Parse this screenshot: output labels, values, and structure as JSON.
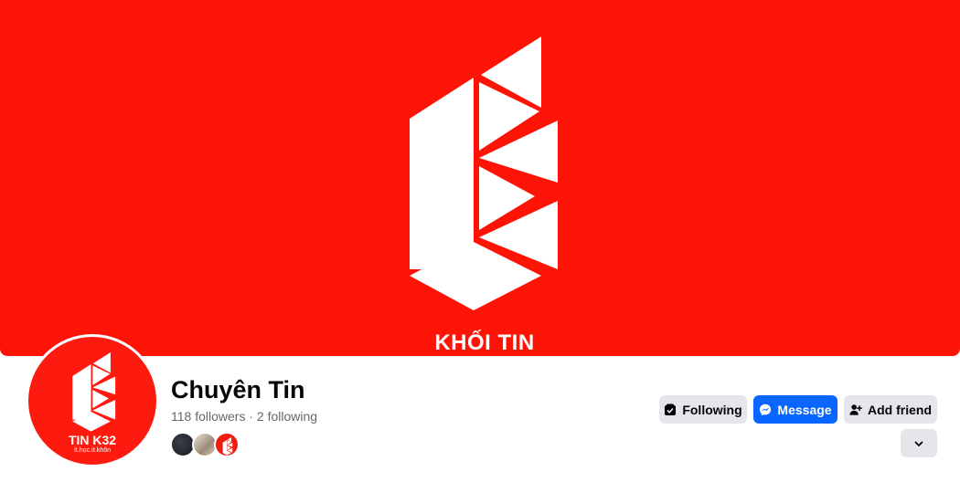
{
  "cover": {
    "caption": "KHỐI TIN",
    "background": "#fe1407"
  },
  "avatar": {
    "title": "TIN K32",
    "subtitle": "ít.học.ít.khôn"
  },
  "profile": {
    "name": "Chuyên Tin",
    "followers": "118 followers",
    "separator": "·",
    "following": "2 following"
  },
  "actions": {
    "following_label": "Following",
    "message_label": "Message",
    "add_friend_label": "Add friend",
    "more_icon": "chevron-down-icon"
  },
  "colors": {
    "brand_red": "#fe1407",
    "messenger_blue": "#0866ff",
    "button_gray": "#e4e6eb",
    "text_primary": "#050505",
    "text_secondary": "#65676b"
  }
}
